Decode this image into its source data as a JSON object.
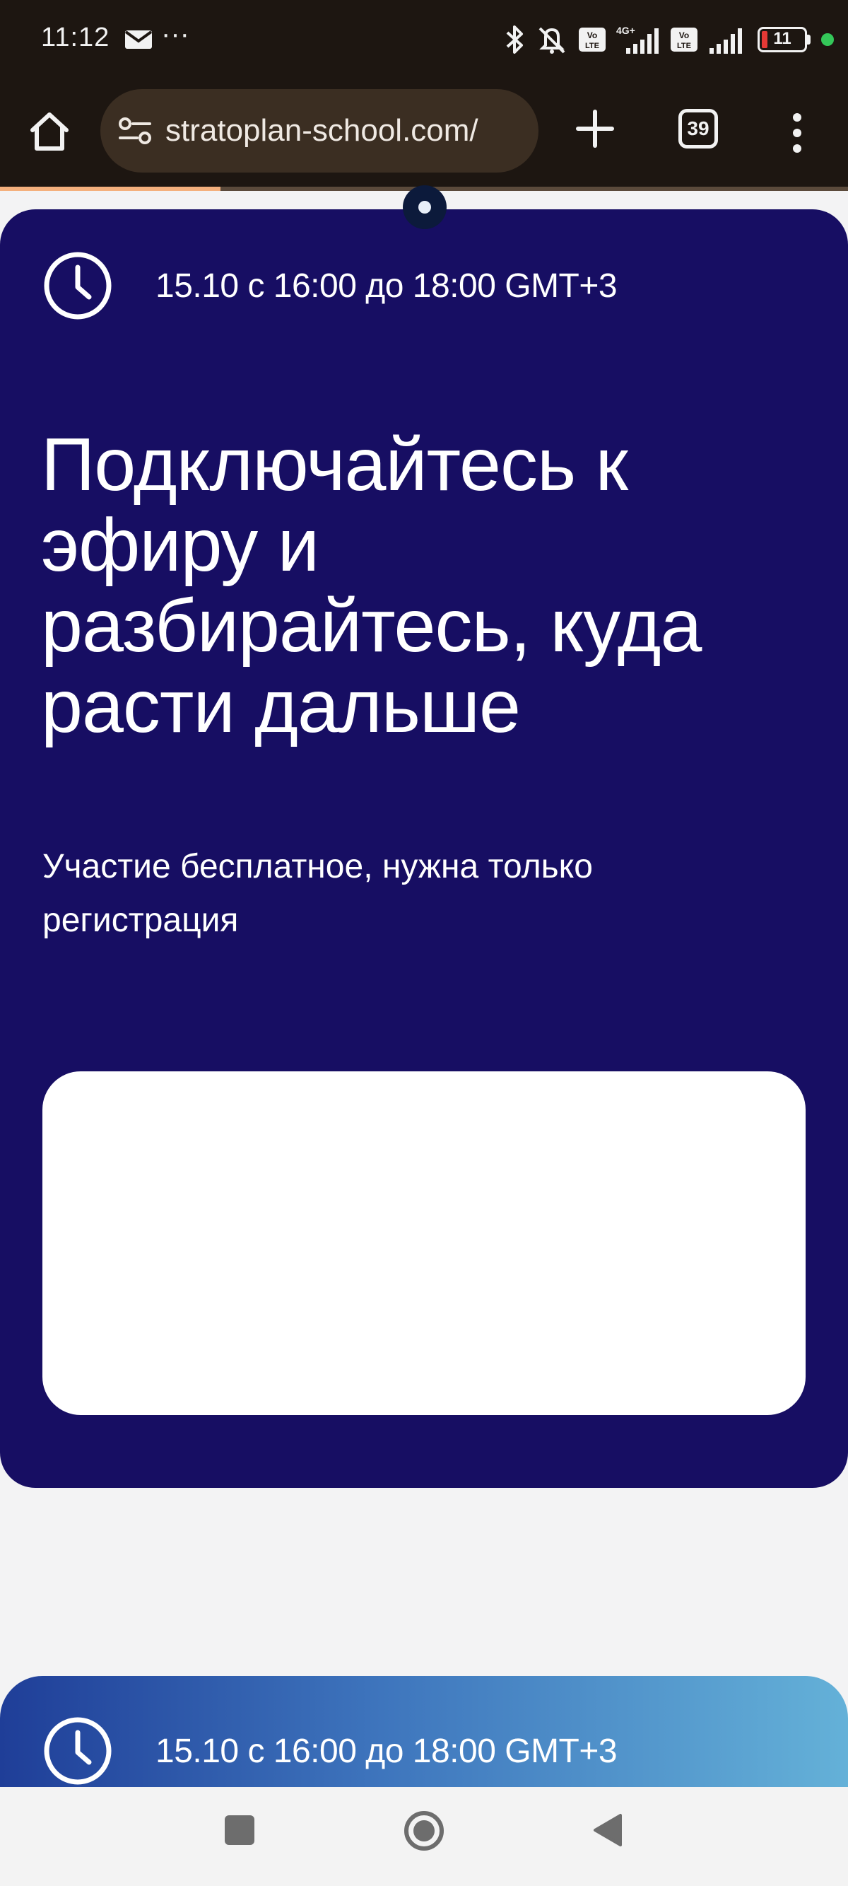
{
  "status_bar": {
    "time": "11:12",
    "more_indicator": "···",
    "battery_level": "11",
    "icons": [
      "mail-icon",
      "bluetooth-icon",
      "mute-icon",
      "volte-icon",
      "signal-4g-icon",
      "volte-icon",
      "signal-icon",
      "battery-icon",
      "privacy-dot-icon"
    ]
  },
  "browser": {
    "url": "stratoplan-school.com/",
    "tab_count": "39",
    "page_load_progress": 0.26
  },
  "event_card": {
    "date_time": "15.10 с 16:00 до 18:00 GMT+3",
    "headline_lines": [
      "Подключайтесь к",
      "эфиру и",
      "разбирайтесь, куда",
      "расти дальше"
    ],
    "subtext_lines": [
      "Участие бесплатное, нужна только",
      "регистрация"
    ]
  },
  "second_card": {
    "date_time": "15.10 с 16:00 до 18:00 GMT+3"
  },
  "colors": {
    "card_background": "#170e63",
    "page_background": "#f3f3f4",
    "browser_chrome": "#1d1611",
    "omnibox": "#3b2e22",
    "gradient_start": "#1f3e98",
    "gradient_end": "#64b1d8",
    "battery_low": "#e53935",
    "privacy_dot": "#34c759"
  }
}
